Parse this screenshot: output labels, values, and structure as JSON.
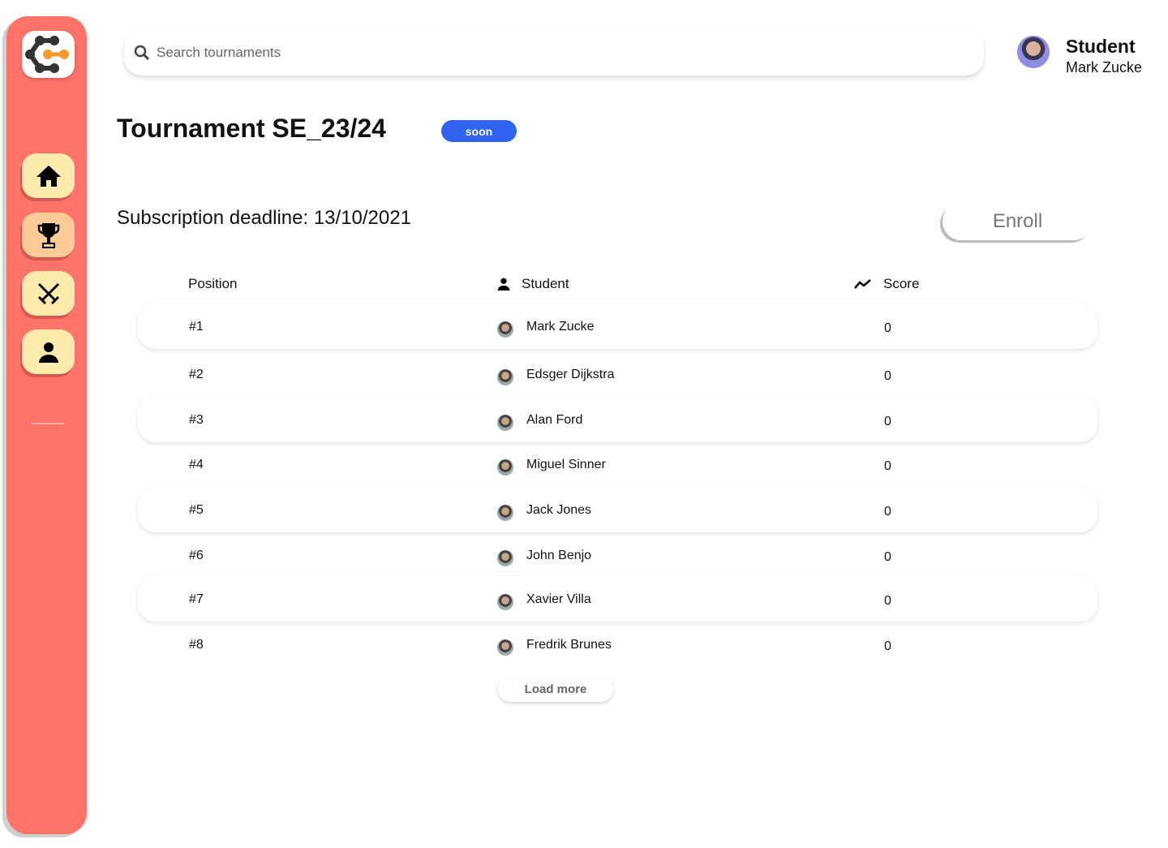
{
  "sidebar": {
    "items": [
      "home-icon",
      "trophy-icon",
      "swords-icon",
      "user-icon"
    ],
    "active": 1,
    "accent": "#ff7369"
  },
  "search": {
    "placeholder": "Search tournaments"
  },
  "user": {
    "role": "Student",
    "name": "Mark Zucke"
  },
  "tournament": {
    "title": "Tournament SE_23/24",
    "status": "soon",
    "deadline": "Subscription deadline: 13/10/2021",
    "enroll_label": "Enroll"
  },
  "table": {
    "headers": {
      "position": "Position",
      "student": "Student",
      "score": "Score"
    },
    "rows": [
      {
        "position": "#1",
        "name": "Mark Zucke",
        "score": "0"
      },
      {
        "position": "#2",
        "name": "Edsger Dijkstra",
        "score": "0"
      },
      {
        "position": "#3",
        "name": "Alan Ford",
        "score": "0"
      },
      {
        "position": "#4",
        "name": "Miguel Sinner",
        "score": "0"
      },
      {
        "position": "#5",
        "name": "Jack Jones",
        "score": "0"
      },
      {
        "position": "#6",
        "name": "John Benjo",
        "score": "0"
      },
      {
        "position": "#7",
        "name": "Xavier Villa",
        "score": "0"
      },
      {
        "position": "#8",
        "name": "Fredrik Brunes",
        "score": "0"
      }
    ]
  },
  "load_more": "Load more"
}
